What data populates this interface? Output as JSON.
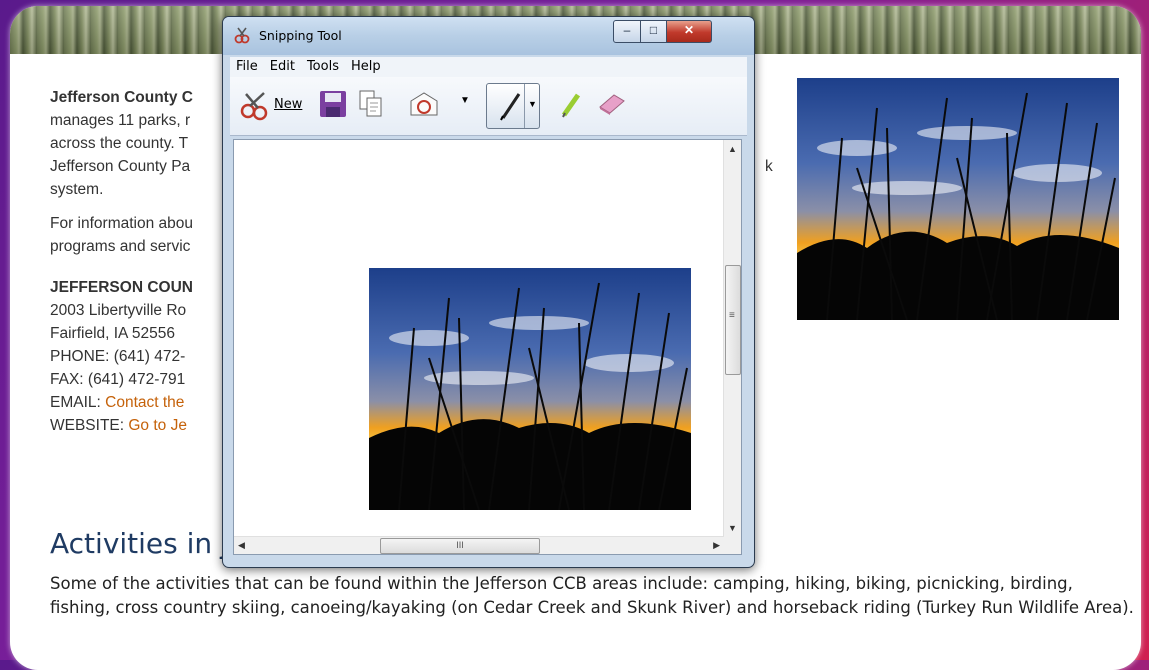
{
  "webpage": {
    "intro_bold": "Jefferson County C",
    "intro_lines": [
      "manages 11 parks, r",
      "across the county.  T",
      "Jefferson County Pa",
      "system."
    ],
    "intro_suffix": "k",
    "info_lines": [
      "For information abou",
      "programs and servic"
    ],
    "contact_heading": "JEFFERSON COUN",
    "address1": "2003 Libertyville Ro",
    "address2": "Fairfield, IA 52556",
    "phone": "PHONE: (641) 472-",
    "fax": "FAX: (641) 472-791",
    "email_label": "EMAIL: ",
    "email_link": "Contact the",
    "website_label": "WEBSITE: ",
    "website_link": "Go to Je",
    "activities_heading": "Activities in J",
    "activities_text": "Some of the activities that can be found within the Jefferson CCB areas include: camping, hiking, biking, picnicking, birding, fishing, cross country skiing, canoeing/kayaking (on Cedar Creek and Skunk River) and horseback riding (Turkey Run Wildlife Area)."
  },
  "snipping_tool": {
    "title": "Snipping Tool",
    "menu": [
      "File",
      "Edit",
      "Tools",
      "Help"
    ],
    "new_label": "New",
    "hscroll_grip": "III",
    "vscroll_grip": "≡"
  },
  "colors": {
    "link": "#c5620a",
    "heading": "#1f3b63",
    "background_gradient": [
      "#5a1a8c",
      "#d02050"
    ]
  }
}
